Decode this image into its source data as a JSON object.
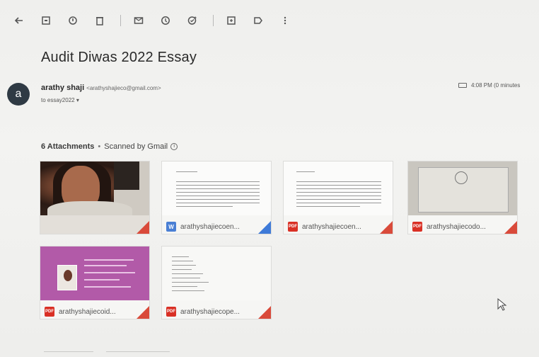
{
  "email": {
    "subject": "Audit Diwas 2022 Essay",
    "avatar_letter": "a",
    "sender_name": "arathy shaji",
    "sender_email": "<arathyshajieco@gmail.com>",
    "to_line": "to essay2022 ▾",
    "time": "4:08 PM (0 minutes"
  },
  "attachments": {
    "count_label": "6 Attachments",
    "separator": "•",
    "scanned_label": "Scanned by Gmail",
    "info_glyph": "i",
    "items": [
      {
        "type": "image",
        "name": ""
      },
      {
        "type": "doc",
        "badge": "W",
        "name": "arathyshajiecoen..."
      },
      {
        "type": "pdf",
        "badge": "PDF",
        "name": "arathyshajiecoen..."
      },
      {
        "type": "pdf",
        "badge": "PDF",
        "name": "arathyshajiecodo..."
      },
      {
        "type": "pdf",
        "badge": "PDF",
        "name": "arathyshajiecoid..."
      },
      {
        "type": "pdf",
        "badge": "PDF",
        "name": "arathyshajiecope..."
      }
    ]
  },
  "toolbar": {
    "icons": [
      "back-arrow-icon",
      "archive-icon",
      "report-spam-icon",
      "delete-icon",
      "mark-unread-icon",
      "snooze-icon",
      "add-task-icon",
      "move-to-icon",
      "label-icon",
      "more-icon"
    ]
  },
  "colors": {
    "pdf_red": "#d93025",
    "doc_blue": "#4a7fd4",
    "avatar": "#2f3a44"
  }
}
